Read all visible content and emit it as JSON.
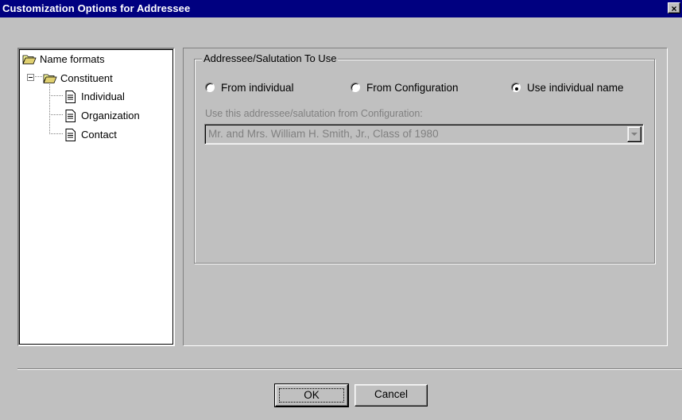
{
  "window": {
    "title": "Customization Options for Addressee",
    "close_glyph": "×"
  },
  "tree": {
    "items": [
      {
        "label": "Name formats",
        "icon": "folder-open-icon"
      },
      {
        "label": "Constituent",
        "icon": "folder-open-icon",
        "expander": "−"
      },
      {
        "label": "Individual",
        "icon": "document-icon"
      },
      {
        "label": "Organization",
        "icon": "document-icon"
      },
      {
        "label": "Contact",
        "icon": "document-icon"
      }
    ]
  },
  "group": {
    "legend": "Addressee/Salutation To Use",
    "options": [
      {
        "label": "From individual",
        "selected": false
      },
      {
        "label": "From Configuration",
        "selected": false
      },
      {
        "label": "Use individual name",
        "selected": true
      }
    ],
    "config_label": "Use this addressee/salutation from Configuration:",
    "config_value": "Mr. and Mrs. William H. Smith, Jr., Class of 1980"
  },
  "buttons": {
    "ok": "OK",
    "cancel": "Cancel"
  },
  "colors": {
    "titlebar": "#000080",
    "face": "#c0c0c0",
    "disabled_text": "#808080"
  }
}
